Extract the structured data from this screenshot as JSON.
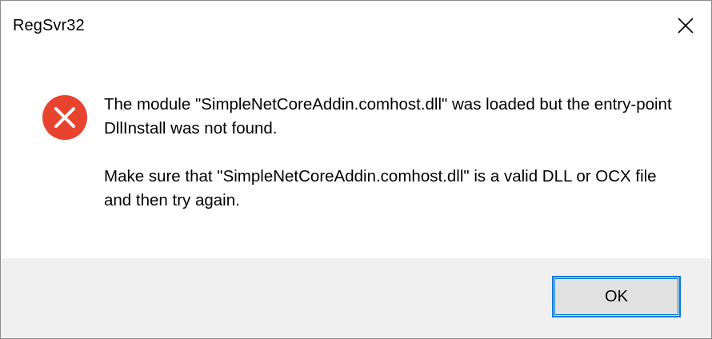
{
  "window": {
    "title": "RegSvr32",
    "close_icon": "close-icon"
  },
  "message": {
    "icon": "error-icon",
    "icon_color": "#e8432f",
    "line1": "The module \"SimpleNetCoreAddin.comhost.dll\" was loaded but the entry-point DllInstall was not found.",
    "line2": "Make sure that \"SimpleNetCoreAddin.comhost.dll\" is a valid DLL or OCX file and then try again."
  },
  "buttons": {
    "ok_label": "OK"
  },
  "colors": {
    "footer_bg": "#f0f0f0",
    "button_border": "#0078d7",
    "button_bg": "#e1e1e1"
  }
}
